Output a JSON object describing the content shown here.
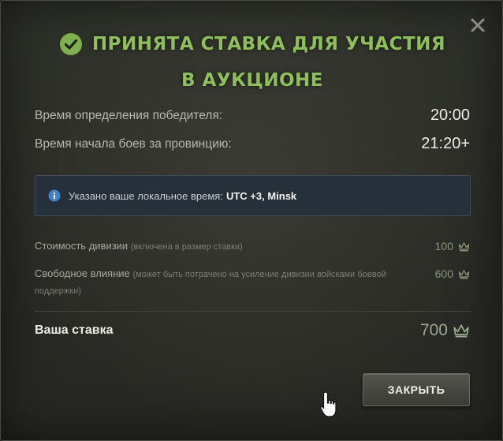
{
  "dialog": {
    "title_line1": "ПРИНЯТА СТАВКА ДЛЯ УЧАСТИЯ",
    "title_line2": "В АУКЦИОНЕ",
    "title_icon": "check-circle-icon",
    "close_icon": "close-icon"
  },
  "times": [
    {
      "label": "Время определения победителя:",
      "value": "20:00"
    },
    {
      "label": "Время начала боев за провинцию:",
      "value": "21:20+"
    }
  ],
  "info": {
    "icon": "info-icon",
    "text": "Указано ваше локальное время:",
    "timezone": "UTC +3, Minsk"
  },
  "costs": [
    {
      "label": "Стоимость дивизии",
      "note": "(включена в размер ставки)",
      "value": "100",
      "icon": "crown-icon"
    },
    {
      "label": "Свободное влияние",
      "note": "(может быть потрачено на усиление дивизии войсками боевой поддержки)",
      "value": "600",
      "icon": "crown-icon"
    }
  ],
  "bid": {
    "label": "Ваша ставка",
    "value": "700",
    "icon": "crown-icon"
  },
  "buttons": {
    "close_label": "ЗАКРЫТЬ"
  },
  "colors": {
    "title_green": "#8fbf5c",
    "info_bg": "#26303b",
    "crown": "#8c9a7a"
  }
}
